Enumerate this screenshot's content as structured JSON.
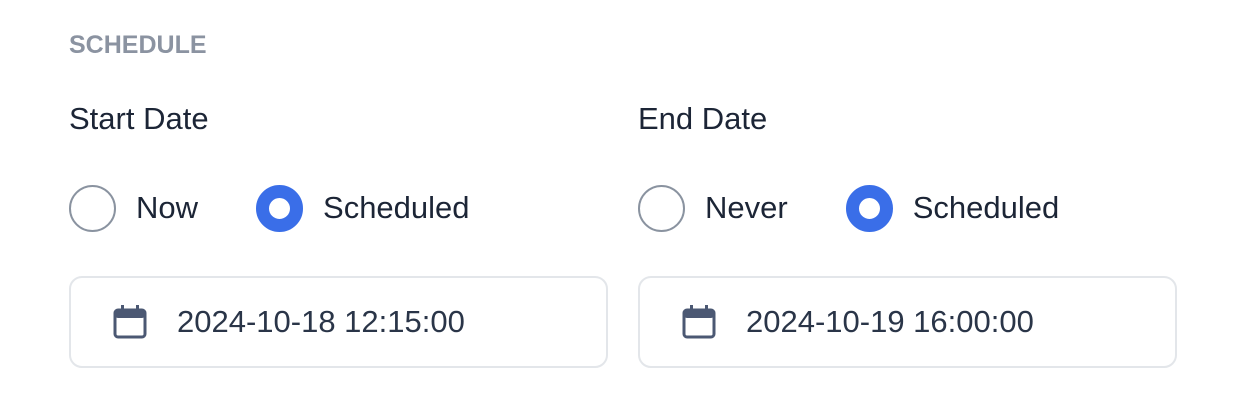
{
  "schedule": {
    "section_label": "SCHEDULE",
    "start": {
      "title": "Start Date",
      "options": [
        {
          "label": "Now",
          "selected": false
        },
        {
          "label": "Scheduled",
          "selected": true
        }
      ],
      "value": "2024-10-18 12:15:00",
      "icon": "calendar-icon"
    },
    "end": {
      "title": "End Date",
      "options": [
        {
          "label": "Never",
          "selected": false
        },
        {
          "label": "Scheduled",
          "selected": true
        }
      ],
      "value": "2024-10-19 16:00:00",
      "icon": "calendar-icon"
    }
  },
  "colors": {
    "accent": "#3a6ee8",
    "label_muted": "#8b93a1",
    "text": "#1c2536",
    "border": "#e3e6ea"
  }
}
